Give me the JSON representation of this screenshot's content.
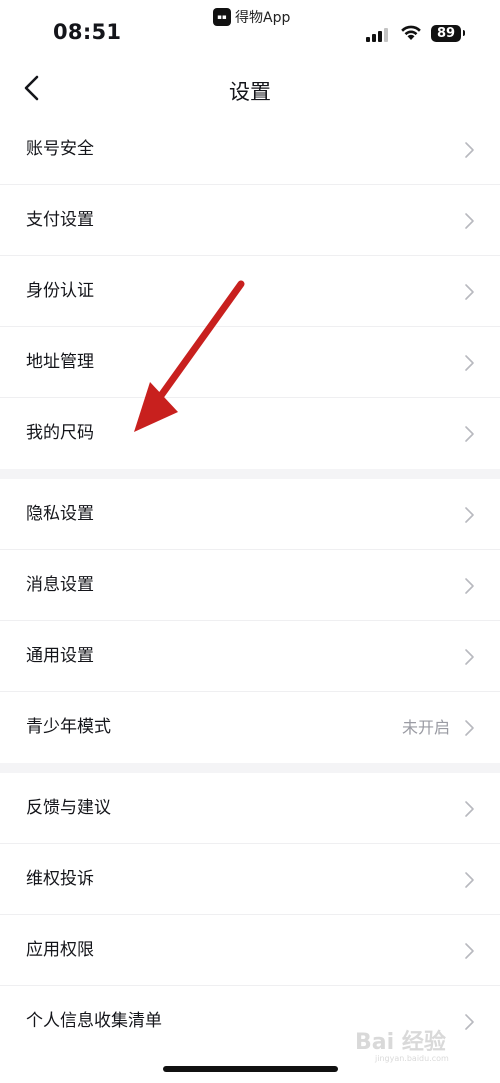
{
  "status_bar": {
    "time": "08:51",
    "source_app": "得物App",
    "battery": "89",
    "icons": [
      "signal-icon",
      "wifi-icon",
      "battery-icon"
    ]
  },
  "nav": {
    "title": "设置",
    "back_icon": "chevron-left-icon"
  },
  "groups": [
    {
      "rows": [
        {
          "label": "账号安全"
        },
        {
          "label": "支付设置"
        },
        {
          "label": "身份认证"
        },
        {
          "label": "地址管理"
        },
        {
          "label": "我的尺码"
        }
      ]
    },
    {
      "rows": [
        {
          "label": "隐私设置"
        },
        {
          "label": "消息设置"
        },
        {
          "label": "通用设置"
        },
        {
          "label": "青少年模式",
          "value": "未开启"
        }
      ]
    },
    {
      "rows": [
        {
          "label": "反馈与建议"
        },
        {
          "label": "维权投诉"
        },
        {
          "label": "应用权限"
        },
        {
          "label": "个人信息收集清单"
        }
      ]
    }
  ],
  "annotation": {
    "type": "red-arrow",
    "points_to": "我的尺码",
    "color": "#c8201e"
  },
  "watermark": {
    "text": "Bai 经验",
    "subtext": "jingyan.baidu.com"
  },
  "colors": {
    "background": "#ffffff",
    "divider": "#f4f4f6",
    "text": "#14151a",
    "secondary_text": "#9a9ba3",
    "chevron": "#b8b9bf"
  }
}
